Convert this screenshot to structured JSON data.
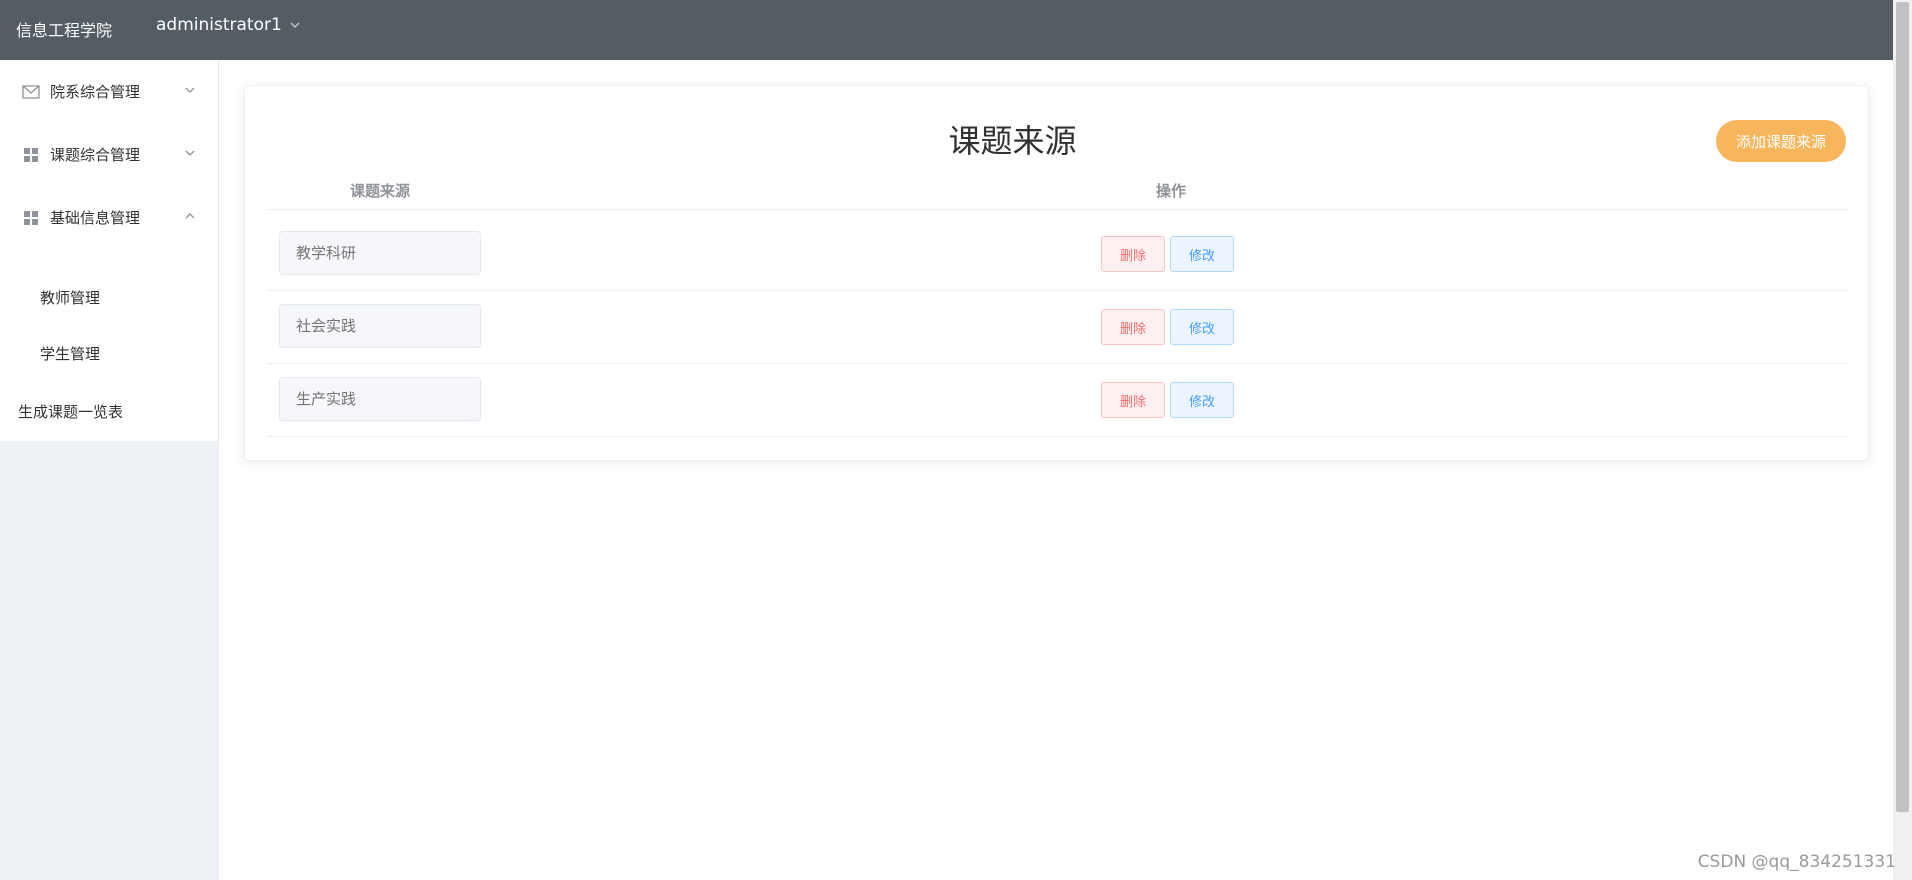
{
  "header": {
    "brand": "信息工程学院",
    "user": "administrator1",
    "bg_color": "#545c64"
  },
  "sidebar": {
    "items": [
      {
        "label": "院系综合管理",
        "icon": "envelope-icon",
        "expanded": false
      },
      {
        "label": "课题综合管理",
        "icon": "grid-icon",
        "expanded": false
      },
      {
        "label": "基础信息管理",
        "icon": "grid-icon",
        "expanded": true
      }
    ],
    "sub_items": [
      "教师管理",
      "学生管理"
    ],
    "bottom_item": "生成课题一览表"
  },
  "main": {
    "title": "课题来源",
    "add_button": "添加课题来源",
    "add_button_color": "#f7b65c",
    "columns": [
      "课题来源",
      "操作"
    ],
    "rows": [
      {
        "placeholder": "教学科研",
        "delete": "删除",
        "edit": "修改"
      },
      {
        "placeholder": "社会实践",
        "delete": "删除",
        "edit": "修改"
      },
      {
        "placeholder": "生产实践",
        "delete": "删除",
        "edit": "修改"
      }
    ]
  },
  "watermark": "CSDN @qq_834251331"
}
